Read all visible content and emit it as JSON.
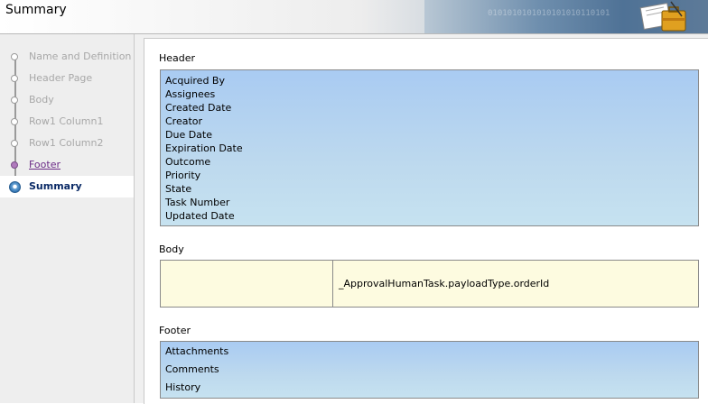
{
  "window": {
    "title": "Summary"
  },
  "banner": {
    "binary_text": "0101010101010101010110101"
  },
  "train": {
    "items": [
      {
        "label": "Name and Definition",
        "state": "disabled"
      },
      {
        "label": "Header Page",
        "state": "disabled"
      },
      {
        "label": "Body",
        "state": "disabled"
      },
      {
        "label": "Row1 Column1",
        "state": "disabled"
      },
      {
        "label": "Row1 Column2",
        "state": "disabled"
      },
      {
        "label": "Footer",
        "state": "visited"
      },
      {
        "label": "Summary",
        "state": "current"
      }
    ]
  },
  "header_section": {
    "label": "Header",
    "fields": [
      "Acquired By",
      "Assignees",
      "Created Date",
      "Creator",
      "Due Date",
      "Expiration Date",
      "Outcome",
      "Priority",
      "State",
      "Task Number",
      "Updated Date"
    ]
  },
  "body_section": {
    "label": "Body",
    "cells": [
      "",
      "_ApprovalHumanTask.payloadType.orderId"
    ]
  },
  "footer_section": {
    "label": "Footer",
    "fields": [
      "Attachments",
      "Comments",
      "History"
    ]
  },
  "colors": {
    "visited": "#6a2a86",
    "current": "#0a2a66",
    "disabled": "#a8a8a8",
    "blue_box": "#b8d5f0",
    "body_box": "#fdfbe0"
  }
}
